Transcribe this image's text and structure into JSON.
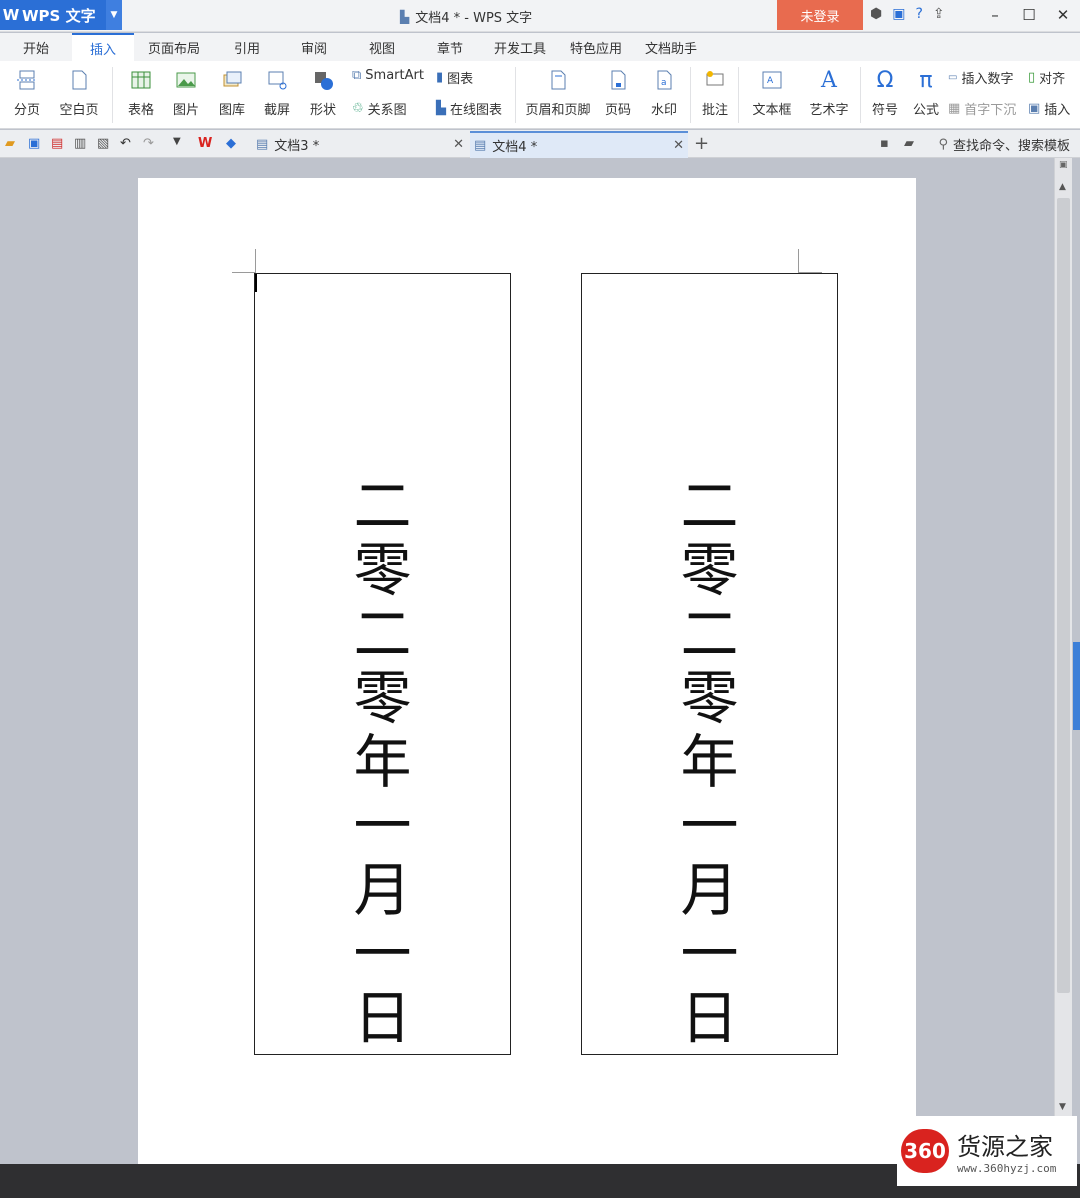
{
  "app": {
    "logo": "W",
    "name": "WPS 文字",
    "window_title": "文档4 * - WPS 文字",
    "login": "未登录"
  },
  "menu_tabs": [
    {
      "label": "开始"
    },
    {
      "label": "插入",
      "active": true
    },
    {
      "label": "页面布局"
    },
    {
      "label": "引用"
    },
    {
      "label": "审阅"
    },
    {
      "label": "视图"
    },
    {
      "label": "章节"
    },
    {
      "label": "开发工具"
    },
    {
      "label": "特色应用"
    },
    {
      "label": "文档助手"
    }
  ],
  "ribbon": {
    "page_break": "分页",
    "blank_page": "空白页",
    "table": "表格",
    "picture": "图片",
    "gallery": "图库",
    "screenshot": "截屏",
    "shape": "形状",
    "smartart": "SmartArt",
    "chart": "图表",
    "relation": "关系图",
    "online_chart": "在线图表",
    "header_footer": "页眉和页脚",
    "page_number": "页码",
    "watermark": "水印",
    "comment": "批注",
    "textbox": "文本框",
    "wordart": "艺术字",
    "symbol": "符号",
    "formula": "公式",
    "insert_number": "插入数字",
    "align": "对齐",
    "dropcap": "首字下沉",
    "insert_obj": "插入"
  },
  "doc_tabs": [
    {
      "label": "文档3 *",
      "active": false
    },
    {
      "label": "文档4 *",
      "active": true
    }
  ],
  "search_hint": "查找命令、搜索模板",
  "document": {
    "box_left_chars": [
      "二",
      "零",
      "二",
      "零",
      "年",
      "一",
      "月",
      "一",
      "日"
    ],
    "box_right_chars": [
      "二",
      "零",
      "二",
      "零",
      "年",
      "一",
      "月",
      "一",
      "日"
    ]
  },
  "watermark": {
    "badge": "360",
    "name": "货源之家",
    "url": "www.360hyzj.com"
  },
  "colors": {
    "accent": "#2b6fd6",
    "login_bg": "#e86b4f",
    "workspace": "#bfc3cc"
  }
}
